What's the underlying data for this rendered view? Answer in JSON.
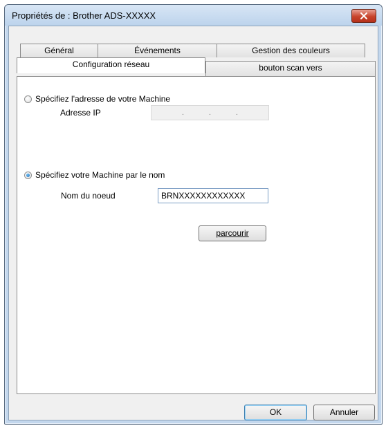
{
  "window": {
    "title": "Propriétés de : Brother ADS-XXXXX"
  },
  "tabs": {
    "row1": [
      {
        "label": "Général"
      },
      {
        "label": "Événements"
      },
      {
        "label": "Gestion des couleurs"
      }
    ],
    "row2": [
      {
        "label": "Configuration réseau",
        "active": true
      },
      {
        "label": "bouton scan vers"
      }
    ]
  },
  "panel": {
    "option_address": {
      "label": "Spécifiez l'adresse de votre Machine",
      "checked": false
    },
    "ip_label": "Adresse IP",
    "ip_value": {
      "dots": [
        ".",
        ".",
        "."
      ]
    },
    "option_name": {
      "label": "Spécifiez votre Machine par le nom",
      "checked": true
    },
    "node_label": "Nom du noeud",
    "node_value": "BRNXXXXXXXXXXXX",
    "browse_button": "parcourir"
  },
  "footer": {
    "ok": "OK",
    "cancel": "Annuler"
  },
  "icons": {
    "close": "close-icon"
  }
}
